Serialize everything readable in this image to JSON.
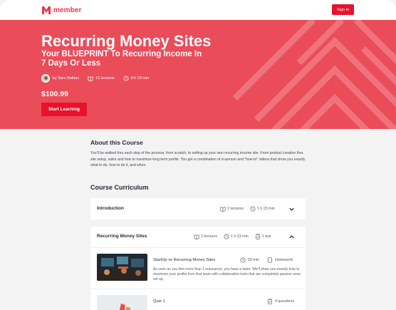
{
  "brand": {
    "name": "member",
    "accent": "#e8384f",
    "button": "#e8122c",
    "hero_bg": "#ea4c5a"
  },
  "nav": {
    "signin_label": "Sign In"
  },
  "hero": {
    "title": "Recurring Money Sites",
    "subtitle": "Your BLUEPRINT To Recurring Income In 7 Days Or Less",
    "author": "by Sam Bakker",
    "lessons": "12 lessons",
    "duration": "8 h 23 min",
    "price": "$100.99",
    "cta_label": "Start Learning"
  },
  "about": {
    "heading": "About this Course",
    "body": "You'll be walked thru each step of the process, from scratch, to setting up your own recurring income site. From product creation thru site setup, sales and how to maximize long term profits. You get a combination of in-person and \"how-to\" videos that show you exactly what to do, how to do it, and when."
  },
  "curriculum": {
    "heading": "Course Curriculum",
    "sections": [
      {
        "title": "Introduction",
        "lectures": "2 lectures",
        "duration": "1 h 23 min",
        "expanded": false
      },
      {
        "title": "Recurring Money Sites",
        "lectures": "2 lectures",
        "duration": "1 h 23 min",
        "tests": "1 test",
        "expanded": true,
        "lessons": [
          {
            "title": "StartUp vs Recurring Money Sites",
            "duration": "59 min",
            "type": "Homework",
            "desc": "As soon as you hire more than 1 outsourcer, you have a team. We'll show you exactly how to maximize your profits from that team with collaboration tools that are completely passive once set up."
          },
          {
            "title": "Quiz 1",
            "questions": "4 questions"
          }
        ]
      }
    ]
  },
  "icons": [
    "logo-m-icon",
    "book-icon",
    "clock-icon",
    "test-icon",
    "chevron-down-icon",
    "chevron-up-icon",
    "homework-icon"
  ]
}
